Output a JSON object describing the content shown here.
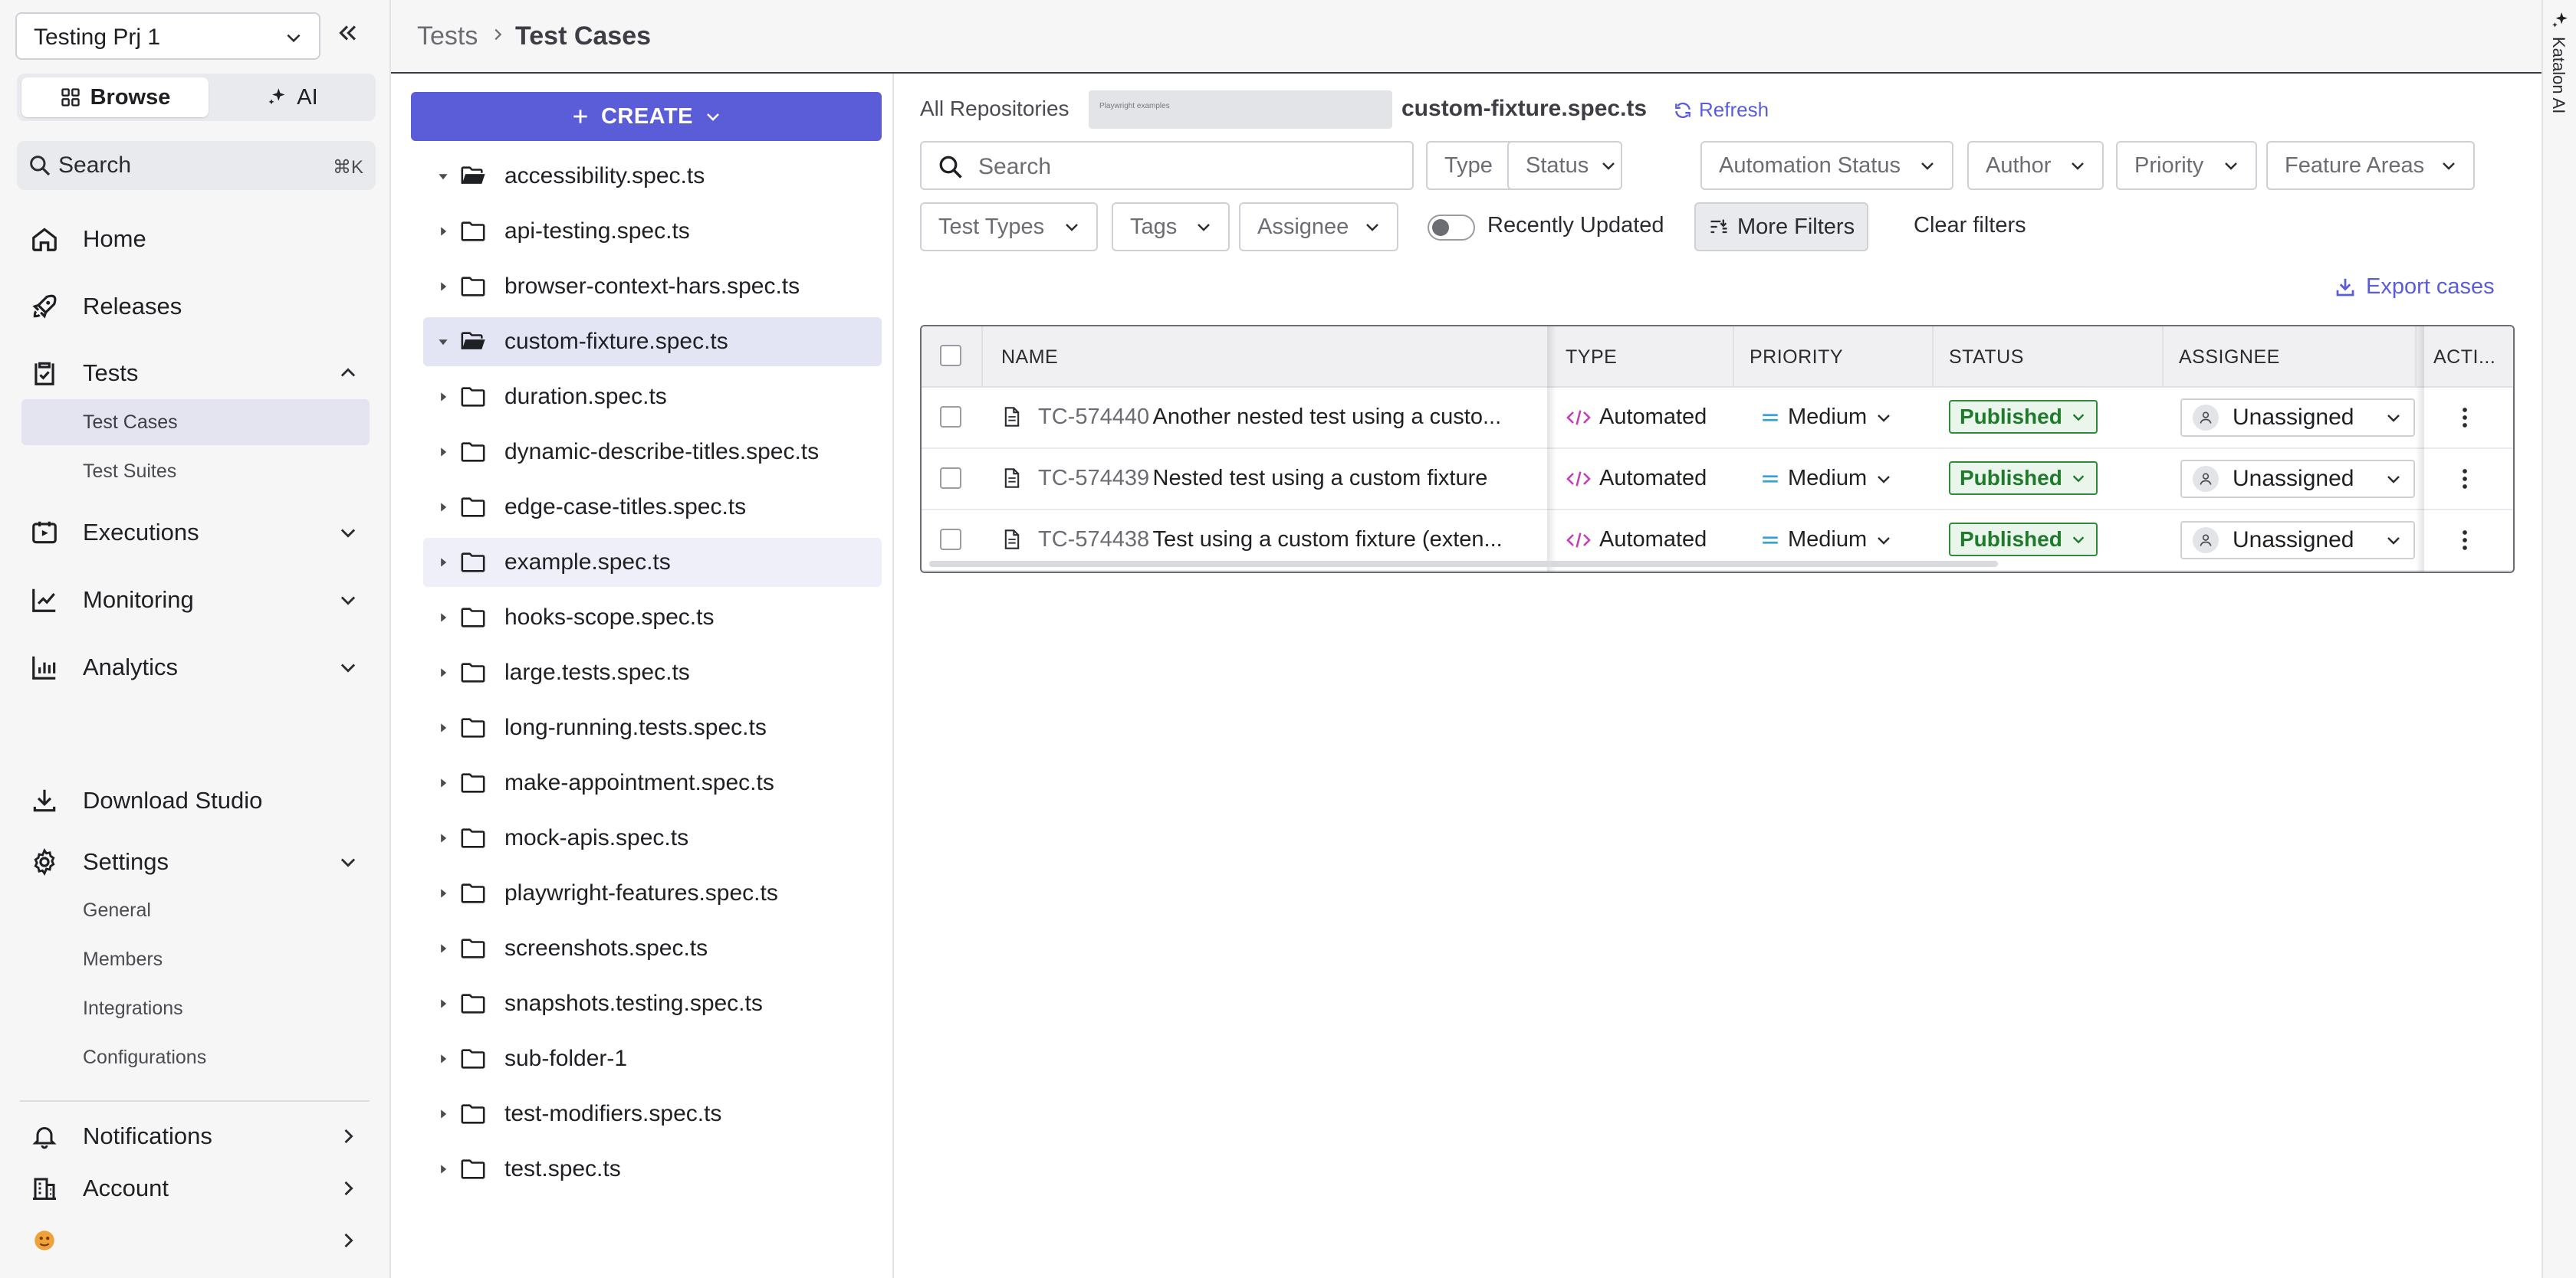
{
  "project": {
    "name": "Testing Prj 1"
  },
  "segment": {
    "browse": "Browse",
    "ai": "AI"
  },
  "sidebar_search": {
    "placeholder": "Search",
    "shortcut": "⌘K"
  },
  "nav": {
    "home": "Home",
    "releases": "Releases",
    "tests": "Tests",
    "tests_sub": [
      "Test Cases",
      "Test Suites"
    ],
    "executions": "Executions",
    "monitoring": "Monitoring",
    "analytics": "Analytics",
    "download_studio": "Download Studio",
    "settings": "Settings",
    "settings_sub": [
      "General",
      "Members",
      "Integrations",
      "Configurations"
    ],
    "notifications": "Notifications",
    "account": "Account"
  },
  "breadcrumb": {
    "parent": "Tests",
    "current": "Test Cases"
  },
  "side_panel": {
    "label": "Katalon AI"
  },
  "create_label": "CREATE",
  "tree": [
    "accessibility.spec.ts",
    "api-testing.spec.ts",
    "browser-context-hars.spec.ts",
    "custom-fixture.spec.ts",
    "duration.spec.ts",
    "dynamic-describe-titles.spec.ts",
    "edge-case-titles.spec.ts",
    "example.spec.ts",
    "hooks-scope.spec.ts",
    "large.tests.spec.ts",
    "long-running.tests.spec.ts",
    "make-appointment.spec.ts",
    "mock-apis.spec.ts",
    "playwright-features.spec.ts",
    "screenshots.spec.ts",
    "snapshots.testing.spec.ts",
    "sub-folder-1",
    "test-modifiers.spec.ts",
    "test.spec.ts"
  ],
  "content": {
    "all_repos": "All Repositories",
    "repo_chip": "Playwright examples",
    "spec": "custom-fixture.spec.ts",
    "refresh": "Refresh",
    "search_placeholder": "Search",
    "filters_row1": [
      "Type",
      "Status",
      "Automation Status",
      "Author",
      "Priority",
      "Feature Areas"
    ],
    "filters_row2": [
      "Test Types",
      "Tags",
      "Assignee"
    ],
    "recently_updated": "Recently Updated",
    "more_filters": "More Filters",
    "clear_filters": "Clear filters",
    "export": "Export cases"
  },
  "table": {
    "headers": {
      "name": "NAME",
      "type": "TYPE",
      "priority": "PRIORITY",
      "status": "STATUS",
      "assignee": "ASSIGNEE",
      "actions": "ACTI..."
    },
    "rows": [
      {
        "id": "TC-574440",
        "title": "Another nested test using a custo...",
        "type": "Automated",
        "priority": "Medium",
        "status": "Published",
        "assignee": "Unassigned"
      },
      {
        "id": "TC-574439",
        "title": "Nested test using a custom fixture",
        "type": "Automated",
        "priority": "Medium",
        "status": "Published",
        "assignee": "Unassigned"
      },
      {
        "id": "TC-574438",
        "title": "Test using a custom fixture (exten...",
        "type": "Automated",
        "priority": "Medium",
        "status": "Published",
        "assignee": "Unassigned"
      }
    ]
  },
  "colors": {
    "accent": "#5a5cd8",
    "status_green": "#2f8a3a",
    "automated_icon": "#c23fb5",
    "priority_icon": "#3aa0d8"
  }
}
